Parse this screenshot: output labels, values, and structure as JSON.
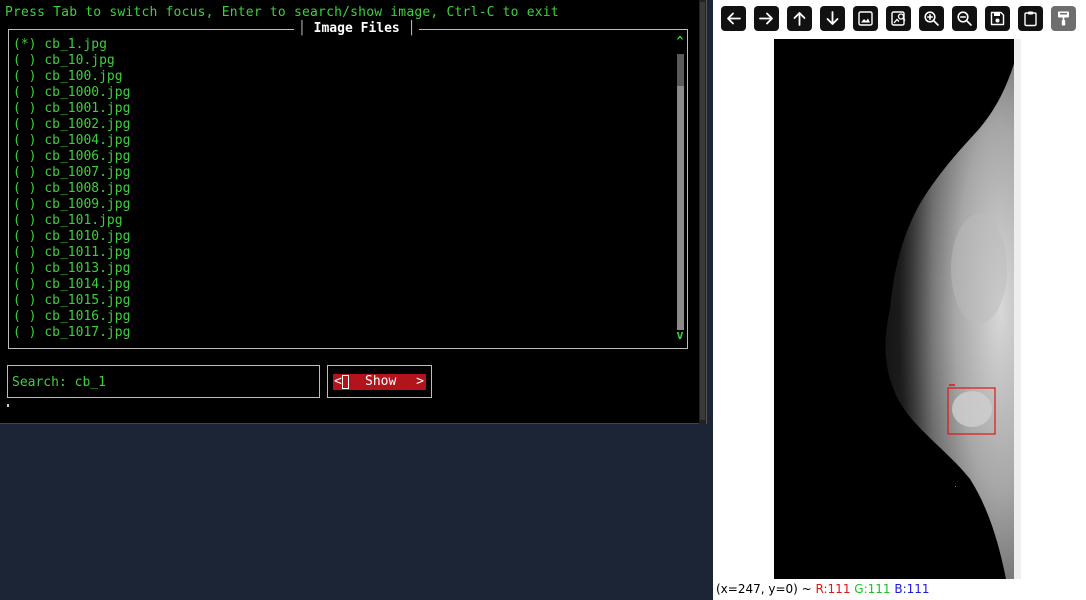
{
  "terminal": {
    "hint": "Press Tab to switch focus, Enter to search/show image, Ctrl-C to exit",
    "panel_title": "Image Files",
    "files": [
      {
        "marker": "(*)",
        "name": "cb_1.jpg"
      },
      {
        "marker": "( )",
        "name": "cb_10.jpg"
      },
      {
        "marker": "( )",
        "name": "cb_100.jpg"
      },
      {
        "marker": "( )",
        "name": "cb_1000.jpg"
      },
      {
        "marker": "( )",
        "name": "cb_1001.jpg"
      },
      {
        "marker": "( )",
        "name": "cb_1002.jpg"
      },
      {
        "marker": "( )",
        "name": "cb_1004.jpg"
      },
      {
        "marker": "( )",
        "name": "cb_1006.jpg"
      },
      {
        "marker": "( )",
        "name": "cb_1007.jpg"
      },
      {
        "marker": "( )",
        "name": "cb_1008.jpg"
      },
      {
        "marker": "( )",
        "name": "cb_1009.jpg"
      },
      {
        "marker": "( )",
        "name": "cb_101.jpg"
      },
      {
        "marker": "( )",
        "name": "cb_1010.jpg"
      },
      {
        "marker": "( )",
        "name": "cb_1011.jpg"
      },
      {
        "marker": "( )",
        "name": "cb_1013.jpg"
      },
      {
        "marker": "( )",
        "name": "cb_1014.jpg"
      },
      {
        "marker": "( )",
        "name": "cb_1015.jpg"
      },
      {
        "marker": "( )",
        "name": "cb_1016.jpg"
      },
      {
        "marker": "( )",
        "name": "cb_1017.jpg"
      }
    ],
    "scroll_up": "^",
    "scroll_down": "v",
    "search_value": "Search: cb_1",
    "show_button": {
      "left": "<",
      "label": "Show",
      "right": ">"
    }
  },
  "viewer": {
    "toolbar_icons": [
      "arrow-left-icon",
      "arrow-right-icon",
      "arrow-up-icon",
      "arrow-down-icon",
      "image-icon",
      "image-search-icon",
      "zoom-in-icon",
      "zoom-out-icon",
      "save-icon",
      "clipboard-icon",
      "paint-roller-icon"
    ],
    "status": {
      "coords": "(x=247, y=0) ~ ",
      "r": "R:111",
      "g": "G:111",
      "b": "B:111"
    }
  },
  "colors": {
    "terminal_text": "#3ecf3e",
    "button_red": "#b3141c",
    "annotation_box": "#e01616",
    "desktop_bg": "#1b2536"
  }
}
